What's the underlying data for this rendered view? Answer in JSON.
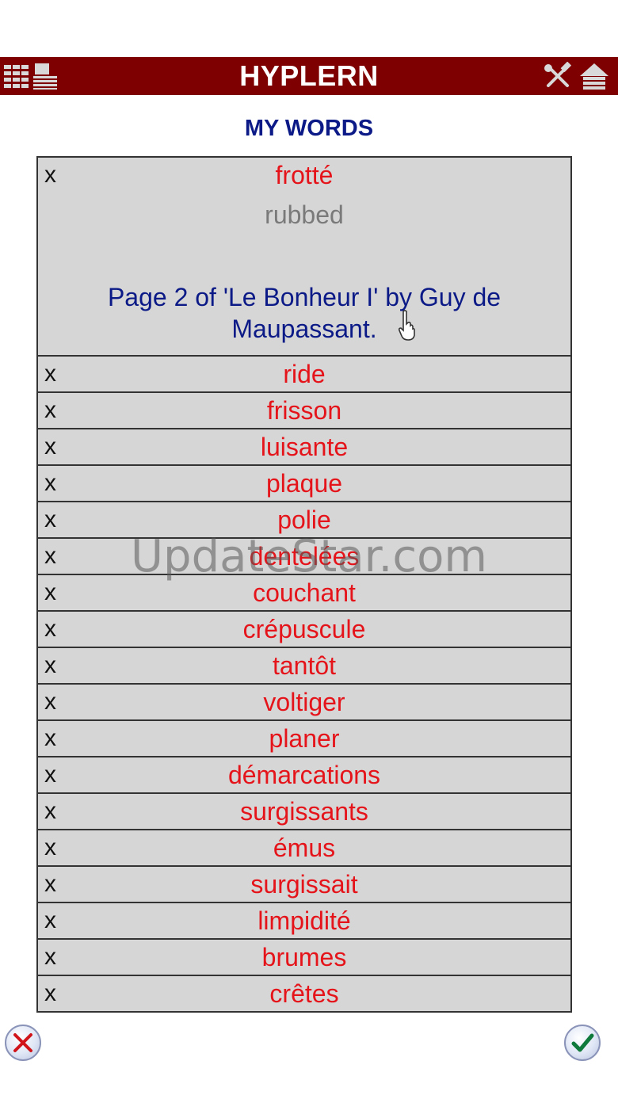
{
  "app": {
    "title": "HYPLERN",
    "left_icons": [
      "grid-icon",
      "list-icon"
    ],
    "right_icons": [
      "tools-icon",
      "home-icon"
    ]
  },
  "heading": "MY WORDS",
  "entries": [
    {
      "delete_label": "x",
      "word": "frotté",
      "translation": "rubbed",
      "source": "Page 2 of 'Le Bonheur I' by Guy de Maupassant."
    },
    {
      "delete_label": "x",
      "word": "ride"
    },
    {
      "delete_label": "x",
      "word": "frisson"
    },
    {
      "delete_label": "x",
      "word": "luisante"
    },
    {
      "delete_label": "x",
      "word": "plaque"
    },
    {
      "delete_label": "x",
      "word": "polie"
    },
    {
      "delete_label": "x",
      "word": "dentelées"
    },
    {
      "delete_label": "x",
      "word": "couchant"
    },
    {
      "delete_label": "x",
      "word": "crépuscule"
    },
    {
      "delete_label": "x",
      "word": "tantôt"
    },
    {
      "delete_label": "x",
      "word": "voltiger"
    },
    {
      "delete_label": "x",
      "word": "planer"
    },
    {
      "delete_label": "x",
      "word": "démarcations"
    },
    {
      "delete_label": "x",
      "word": "surgissants"
    },
    {
      "delete_label": "x",
      "word": "émus"
    },
    {
      "delete_label": "x",
      "word": "surgissait"
    },
    {
      "delete_label": "x",
      "word": "limpidité"
    },
    {
      "delete_label": "x",
      "word": "brumes"
    },
    {
      "delete_label": "x",
      "word": "crêtes"
    }
  ],
  "watermark": "UpdateStar.com",
  "footer": {
    "cancel_icon": "cancel-icon",
    "confirm_icon": "checkmark-icon"
  },
  "colors": {
    "titlebar": "#7f0000",
    "heading": "#0b1a86",
    "word": "#e5141a",
    "translation": "#7a7a7a",
    "row_bg": "#d6d6d6"
  }
}
